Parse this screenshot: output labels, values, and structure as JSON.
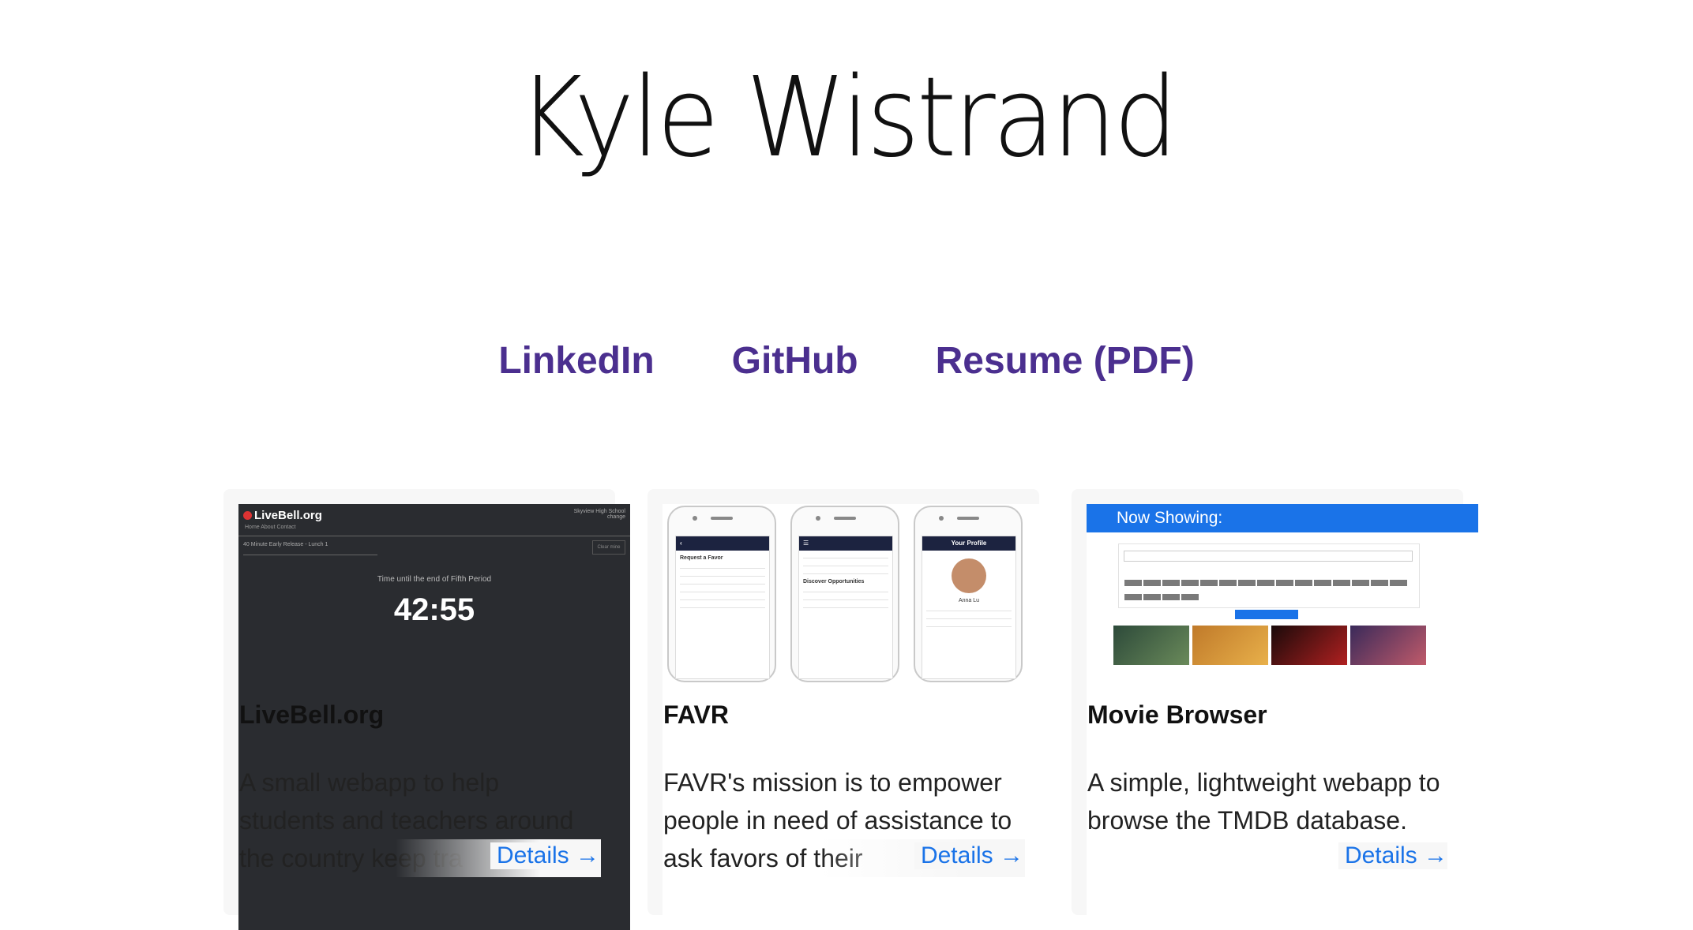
{
  "header": {
    "name": "Kyle Wistrand"
  },
  "links": [
    {
      "label": "LinkedIn"
    },
    {
      "label": "GitHub"
    },
    {
      "label": "Resume (PDF)"
    }
  ],
  "projects": [
    {
      "title": "LiveBell.org",
      "description": "A small webapp to help students and teachers around the country keep tra",
      "details_label": "Details →",
      "screenshot": {
        "brand": "LiveBell.org",
        "nav": "Home   About   Contact",
        "school": "Skyview High School",
        "school_link": "change",
        "schedule": "40 Minute Early Release - Lunch 1",
        "clear": "Clear mine",
        "caption": "Time until the end of Fifth Period",
        "timer": "42:55"
      }
    },
    {
      "title": "FAVR",
      "description": "FAVR's mission is to empower people in need of assistance to ask favors of their",
      "details_label": "Details →",
      "screenshot": {
        "screen1_title": "Request a Favor",
        "screen2_title": "Discover Opportunities",
        "screen3_title": "Your Profile",
        "profile_name": "Anna Lu"
      }
    },
    {
      "title": "Movie Browser",
      "description": "A simple, lightweight webapp to browse the TMDB database.",
      "details_label": "Details →",
      "screenshot": {
        "header": "Now Showing:"
      }
    }
  ],
  "colors": {
    "link": "#4b2f8f",
    "details": "#1a73e8",
    "card_bg": "#f7f7f7"
  }
}
